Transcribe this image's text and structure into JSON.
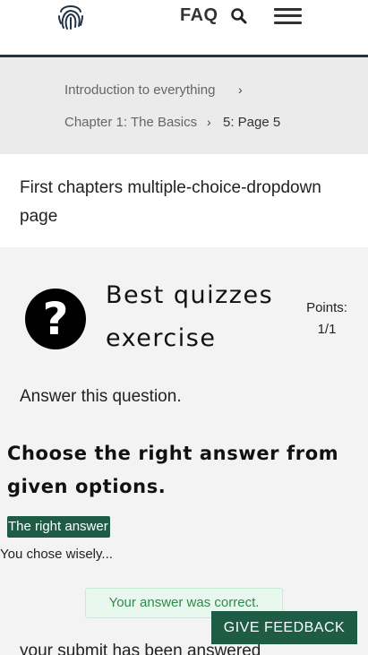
{
  "header": {
    "faq_label": "FAQ",
    "logo_icon": "fingerprint-icon",
    "search_icon": "search-icon",
    "menu_icon": "hamburger-menu-icon"
  },
  "breadcrumb": {
    "items": [
      {
        "label": "Introduction to everything"
      },
      {
        "label": "Chapter 1: The Basics"
      }
    ],
    "separator": "›",
    "current": "5: Page 5"
  },
  "page": {
    "title": "First chapters multiple-choice-dropdown page"
  },
  "exercise": {
    "icon": "question-mark-icon",
    "title": "Best quizzes exercise",
    "points_label": "Points:",
    "points_value": "1/1",
    "instruction": "Answer this question.",
    "question": "Choose the right answer from given options.",
    "selected_answer": "The right answer",
    "chose_text": "You chose wisely...",
    "result_message": "Your answer was correct.",
    "submitted_text": "your submit has been answered"
  },
  "feedback_button": {
    "label": "GIVE FEEDBACK"
  },
  "colors": {
    "accent_green": "#1e5c46",
    "header_border": "#1f3347",
    "success_bg": "#e9f8ee",
    "success_text": "#2e8a4a"
  }
}
